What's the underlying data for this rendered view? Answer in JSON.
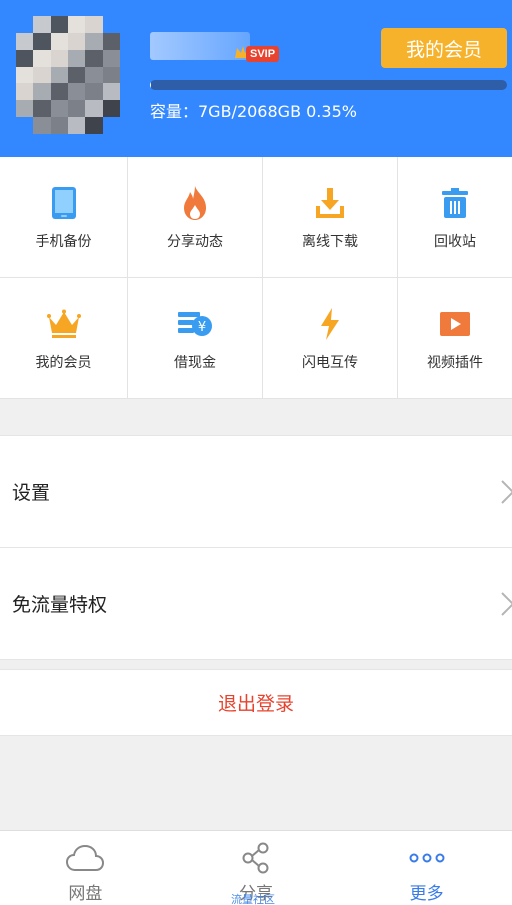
{
  "header": {
    "member_button": "我的会员",
    "vip_badge": "SVIP",
    "capacity_text": "容量：7GB/2068GB 0.35%",
    "storage_used_fraction": 0.0035
  },
  "grid": [
    {
      "label": "手机备份",
      "icon": "phone-backup-icon"
    },
    {
      "label": "分享动态",
      "icon": "flame-icon"
    },
    {
      "label": "离线下载",
      "icon": "download-icon"
    },
    {
      "label": "回收站",
      "icon": "trash-icon"
    },
    {
      "label": "我的会员",
      "icon": "crown-icon"
    },
    {
      "label": "借现金",
      "icon": "cash-icon"
    },
    {
      "label": "闪电互传",
      "icon": "lightning-icon"
    },
    {
      "label": "视频插件",
      "icon": "video-icon"
    }
  ],
  "list": {
    "settings": "设置",
    "free_traffic": "免流量特权"
  },
  "logout": "退出登录",
  "tabs": {
    "disk": "网盘",
    "share": "分享",
    "more": "更多"
  },
  "watermark": "流量社区",
  "colors": {
    "header_bg": "#3388ff",
    "member_button": "#f6b22b",
    "logout": "#e8432e",
    "active_tab": "#3a7be8"
  }
}
